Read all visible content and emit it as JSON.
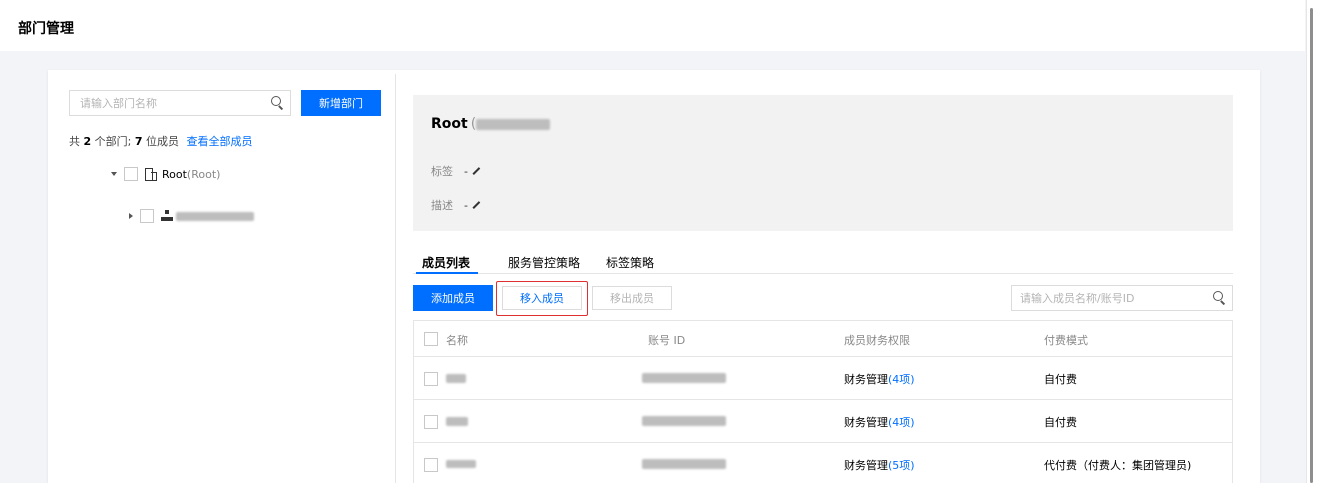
{
  "page": {
    "title": "部门管理"
  },
  "left": {
    "search_placeholder": "请输入部门名称",
    "add_department": "新增部门",
    "summary": {
      "prefix": "共",
      "dept_count": "2",
      "dept_text": "个部门;",
      "member_count": "7",
      "member_text": "位成员",
      "view_all": "查看全部成员"
    },
    "tree": [
      {
        "label": "Root",
        "sub": "(Root)",
        "expanded": true
      },
      {
        "label": "",
        "expanded": false
      }
    ]
  },
  "detail": {
    "title": "Root",
    "paren": "(",
    "tag_label": "标签",
    "tag_value": "-",
    "desc_label": "描述",
    "desc_value": "-"
  },
  "tabs": [
    {
      "label": "成员列表",
      "active": true
    },
    {
      "label": "服务管控策略",
      "active": false
    },
    {
      "label": "标签策略",
      "active": false
    }
  ],
  "actions": {
    "add_member": "添加成员",
    "move_in": "移入成员",
    "move_out": "移出成员",
    "search_placeholder": "请输入成员名称/账号ID"
  },
  "table": {
    "headers": {
      "name": "名称",
      "account_id": "账号 ID",
      "finance": "成员财务权限",
      "payment": "付费模式"
    },
    "rows": [
      {
        "finance_prefix": "财务管理",
        "finance_count": "(4项)",
        "payment": "自付费"
      },
      {
        "finance_prefix": "财务管理",
        "finance_count": "(4项)",
        "payment": "自付费"
      },
      {
        "finance_prefix": "财务管理",
        "finance_count": "(5项)",
        "payment": "代付费（付费人：集团管理员)"
      }
    ]
  },
  "colors": {
    "primary": "#006eff",
    "highlight": "#e02f2f"
  }
}
